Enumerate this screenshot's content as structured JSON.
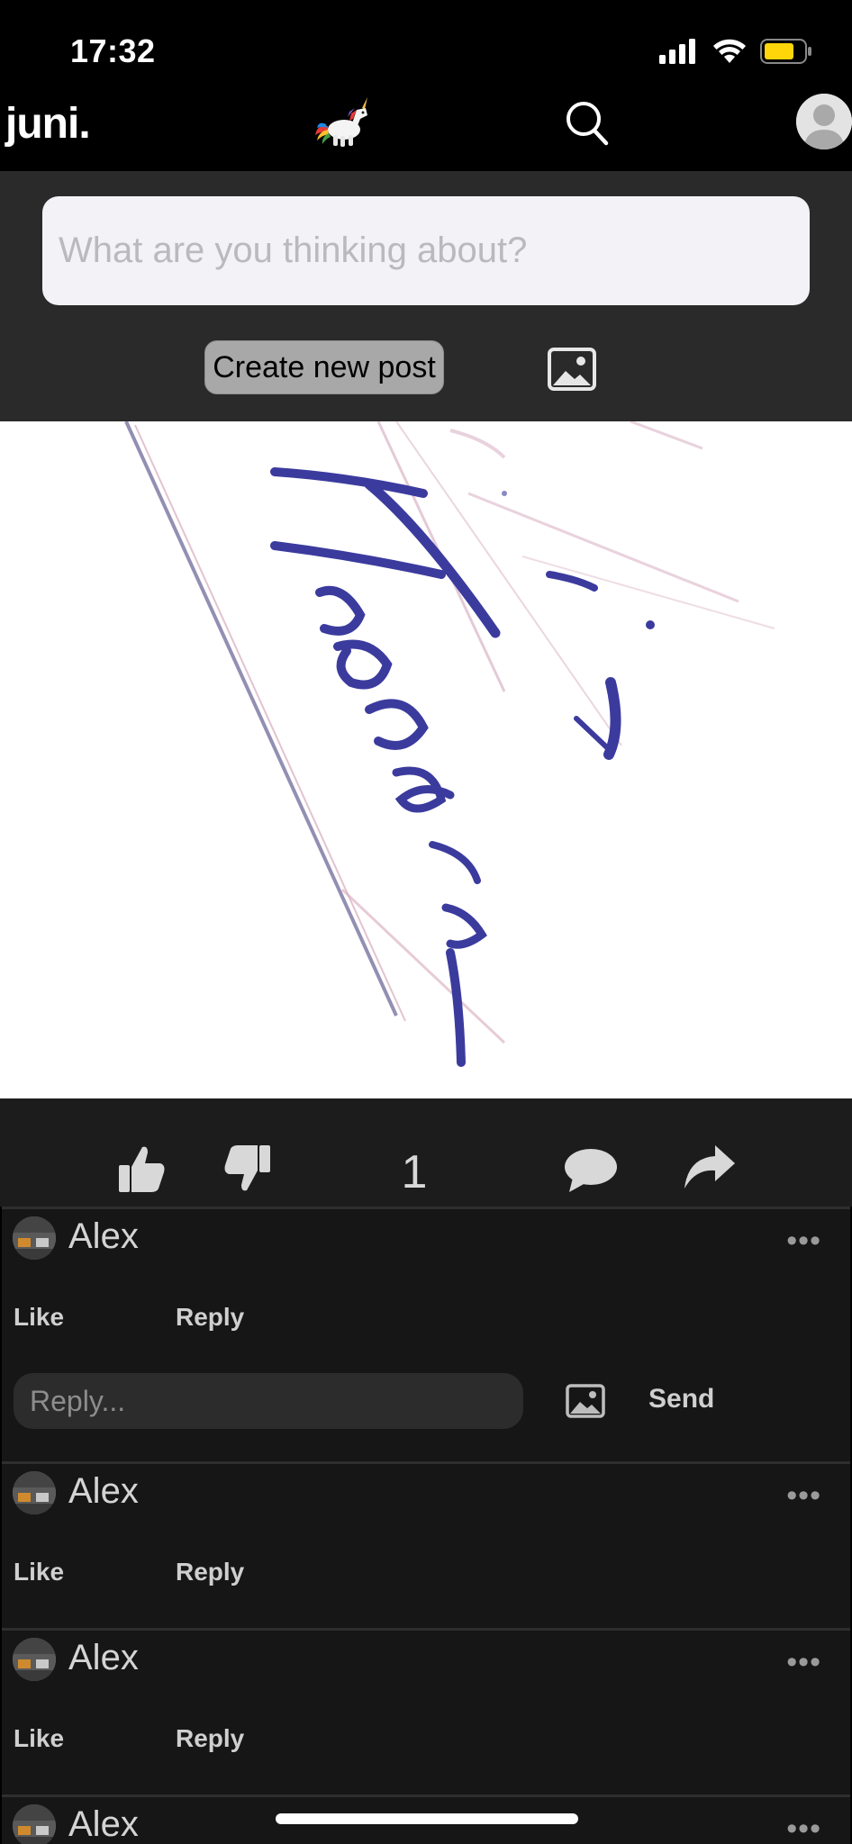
{
  "status_bar": {
    "time": "17:32"
  },
  "header": {
    "brand": "juni.",
    "icons": {
      "logo": "unicorn-logo",
      "search": "search-icon",
      "profile": "avatar"
    }
  },
  "composer": {
    "placeholder": "What are you thinking about?",
    "create_label": "Create new post",
    "image_icon": "image-icon"
  },
  "post": {
    "image": "handwritten-signature-photo",
    "likes": "1",
    "icons": [
      "thumbs-up-icon",
      "thumbs-down-icon",
      "comment-icon",
      "share-icon"
    ]
  },
  "comments": [
    {
      "author": "Alex",
      "like_label": "Like",
      "reply_label": "Reply",
      "more": "•••",
      "reply_box": {
        "placeholder": "Reply...",
        "send_label": "Send"
      }
    },
    {
      "author": "Alex",
      "like_label": "Like",
      "reply_label": "Reply",
      "more": "•••"
    },
    {
      "author": "Alex",
      "like_label": "Like",
      "reply_label": "Reply",
      "more": "•••"
    },
    {
      "author": "Alex",
      "more": "•••"
    }
  ],
  "colors": {
    "background": "#000000",
    "surface": "#2a2a2a",
    "comment_bg": "#161616",
    "battery": "#ffd60a"
  }
}
